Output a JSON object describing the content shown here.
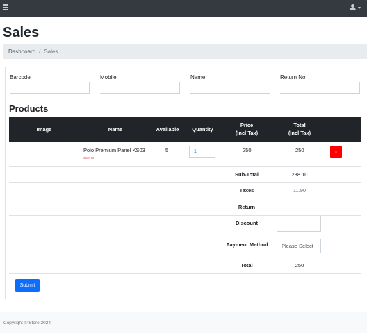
{
  "topbar": {
    "menu_icon": "hamburger-icon",
    "user_icon": "user-icon"
  },
  "page": {
    "title": "Sales"
  },
  "breadcrumb": {
    "items": [
      "Dashboard",
      "Sales"
    ],
    "separator": "/"
  },
  "filters": [
    {
      "label": "Barcode",
      "value": ""
    },
    {
      "label": "Mobile",
      "value": ""
    },
    {
      "label": "Name",
      "value": ""
    },
    {
      "label": "Return No",
      "value": ""
    }
  ],
  "products": {
    "title": "Products",
    "columns": {
      "image": "Image",
      "name": "Name",
      "available": "Available",
      "quantity": "Quantity",
      "price_line1": "Price",
      "price_line2": "(Incl Tax)",
      "total_line1": "Total",
      "total_line2": "(Incl Tax)"
    },
    "rows": [
      {
        "name": "Polo Premium Panel KS03",
        "sub": "Size: M",
        "available": "5",
        "quantity": "1",
        "price": "250",
        "total": "250",
        "delete_label": "x"
      }
    ]
  },
  "summary": {
    "subtotal_label": "Sub-Total",
    "subtotal_value": "238.10",
    "taxes_label": "Taxes",
    "taxes_value": "11.90",
    "return_label": "Return",
    "discount_label": "Discount",
    "discount_value": "",
    "payment_label": "Payment Method",
    "payment_value": "Please Select",
    "total_label": "Total",
    "total_value": "250"
  },
  "actions": {
    "submit_label": "Submit"
  },
  "footer": {
    "text": "Copyright © Store 2024"
  },
  "colors": {
    "topbar": "#343a40",
    "table_header": "#212529",
    "primary": "#0d6efd",
    "danger": "#ff0000"
  }
}
